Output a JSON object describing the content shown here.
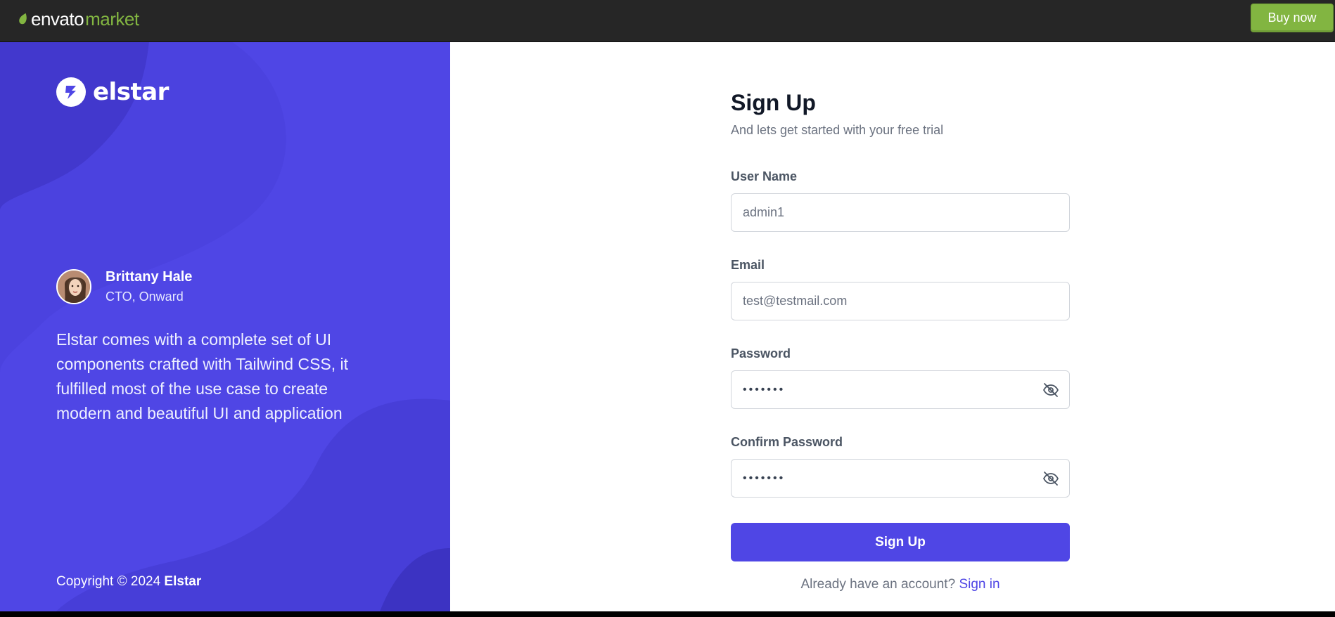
{
  "topbar": {
    "logo_envato": "envato",
    "logo_market": "market",
    "buy_label": "Buy now",
    "accent": "#82b541"
  },
  "left": {
    "brand_name": "elstar",
    "person_name": "Brittany Hale",
    "person_role": "CTO, Onward",
    "quote": "Elstar comes with a complete set of UI components crafted with Tailwind CSS, it fulfilled most of the use case to create modern and beautiful UI and application",
    "copyright_prefix": "Copyright © 2024 ",
    "copyright_brand": "Elstar",
    "background": "#4f46e5"
  },
  "form": {
    "title": "Sign Up",
    "subtitle": "And lets get started with your free trial",
    "username_label": "User Name",
    "username_value": "admin1",
    "email_label": "Email",
    "email_value": "test@testmail.com",
    "password_label": "Password",
    "password_value": "•••••••",
    "confirm_label": "Confirm Password",
    "confirm_value": "•••••••",
    "submit_label": "Sign Up",
    "account_prompt": "Already have an account? ",
    "signin_link": "Sign in",
    "primary": "#4f46e5"
  }
}
